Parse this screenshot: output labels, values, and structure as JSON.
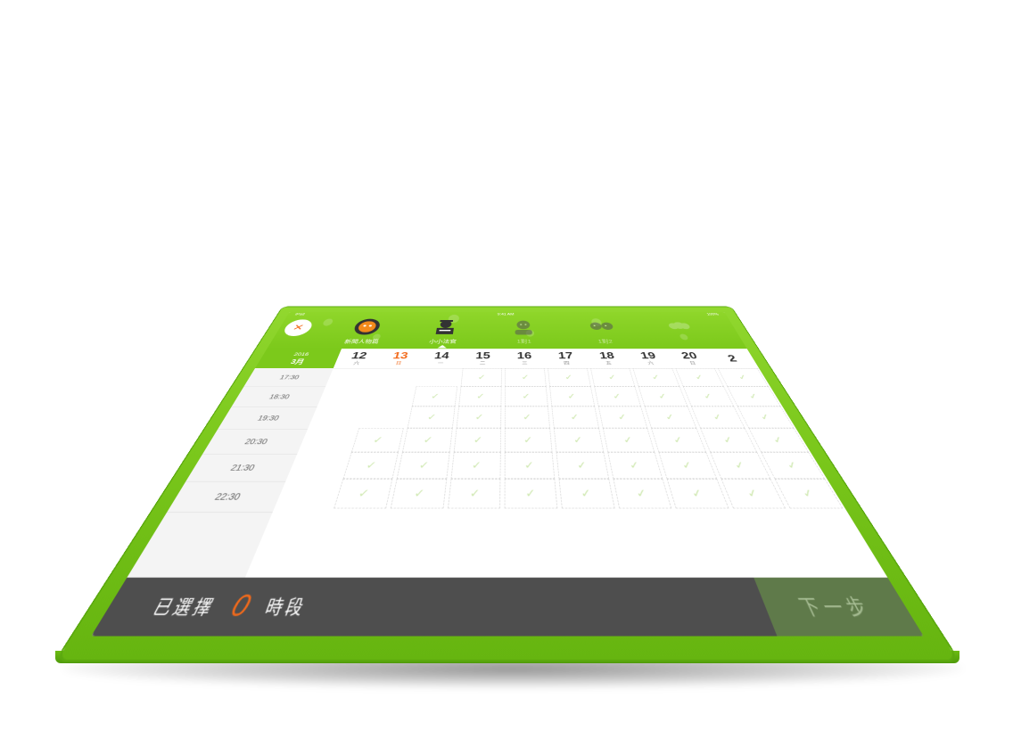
{
  "status": {
    "carrier": "iPad",
    "time": "9:41 AM",
    "battery": "100%"
  },
  "logo": {
    "icon": "close-icon",
    "glyph": "✕"
  },
  "tabs": [
    {
      "label": "新聞人物篇",
      "icon": "reporter-icon",
      "state": "normal"
    },
    {
      "label": "小小法官",
      "icon": "judge-icon",
      "state": "active"
    },
    {
      "label": "1對1",
      "icon": "one-person-icon",
      "state": "dim"
    },
    {
      "label": "1對2",
      "icon": "two-person-icon",
      "state": "dim"
    },
    {
      "label": "",
      "icon": "group-icon",
      "state": "dim"
    }
  ],
  "calendar": {
    "year": "2016",
    "month": "3月",
    "days": [
      {
        "num": "12",
        "wk": "六",
        "today": false
      },
      {
        "num": "13",
        "wk": "日",
        "today": true
      },
      {
        "num": "14",
        "wk": "一",
        "today": false
      },
      {
        "num": "15",
        "wk": "二",
        "today": false
      },
      {
        "num": "16",
        "wk": "三",
        "today": false
      },
      {
        "num": "17",
        "wk": "四",
        "today": false
      },
      {
        "num": "18",
        "wk": "五",
        "today": false
      },
      {
        "num": "19",
        "wk": "六",
        "today": false
      },
      {
        "num": "20",
        "wk": "日",
        "today": false
      },
      {
        "num": "2",
        "wk": "",
        "today": false
      }
    ],
    "times": [
      "17:30",
      "18:30",
      "19:30",
      "20:30",
      "21:30",
      "22:30"
    ],
    "slot_mark": "✓"
  },
  "footer": {
    "selected_label": "已選擇",
    "selected_count": "0",
    "unit": "時段",
    "next_label": "下一步"
  },
  "colors": {
    "brand": "#7cc91b",
    "accent": "#f26a1b",
    "footer": "#4e4e4e"
  }
}
